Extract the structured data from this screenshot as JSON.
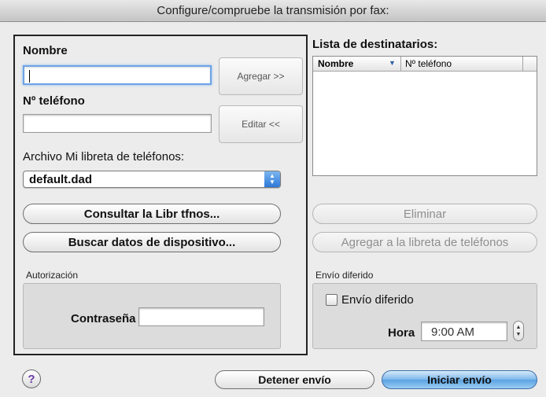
{
  "window": {
    "title": "Configure/compruebe la transmisión por fax:"
  },
  "left": {
    "nombre_label": "Nombre",
    "nombre_value": "",
    "telefono_label": "Nº teléfono",
    "telefono_value": "",
    "agregar_button": "Agregar  >>",
    "editar_button": "Editar <<",
    "archivo_label": "Archivo Mi libreta de teléfonos:",
    "archivo_selected": "default.dad",
    "consultar_button": "Consultar la Libr tfnos...",
    "buscar_button": "Buscar datos de dispositivo...",
    "autorizacion_label": "Autorización",
    "contrasena_label": "Contraseña",
    "contrasena_value": ""
  },
  "right": {
    "lista_label": "Lista de destinatarios:",
    "columns": {
      "nombre": "Nombre",
      "telefono": "Nº teléfono"
    },
    "rows": [],
    "eliminar_button": "Eliminar",
    "agregar_libreta_button": "Agregar a la libreta de teléfonos",
    "envio_diferido_group": "Envío diferido",
    "envio_diferido_checkbox": "Envío diferido",
    "envio_diferido_checked": false,
    "hora_label": "Hora",
    "hora_value": "9:00 AM"
  },
  "footer": {
    "help_icon": "?",
    "detener_button": "Detener envío",
    "iniciar_button": "Iniciar envío"
  },
  "colors": {
    "primary_button": "#6aaee6",
    "focus_ring": "#6ea4e6",
    "help_icon": "#6a3aa8"
  }
}
